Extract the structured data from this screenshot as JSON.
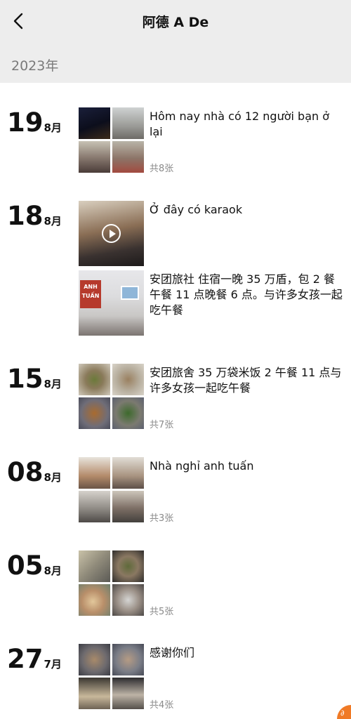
{
  "header": {
    "title": "阿德 A De"
  },
  "year": "2023年",
  "icons": {
    "back": "chevron-left-icon",
    "play": "play-icon",
    "corner": "share-badge-icon"
  },
  "entries": [
    {
      "day": "19",
      "month": "8月",
      "caption": "Hôm nay nhà có 12 người bạn ở lại",
      "count": "共8张"
    },
    {
      "day": "18",
      "month": "8月",
      "caption": "Ở đây có karaok",
      "count": ""
    },
    {
      "day": "",
      "month": "",
      "caption": "安团旅社 住宿一晚 35 万盾，包 2 餐 午餐 11 点晚餐 6 点。与许多女孩一起吃午餐",
      "count": ""
    },
    {
      "day": "15",
      "month": "8月",
      "caption": "安团旅舍 35 万袋米饭 2 午餐 11 点与许多女孩一起吃午餐",
      "count": "共7张"
    },
    {
      "day": "08",
      "month": "8月",
      "caption": "Nhà nghỉ anh tuấn",
      "count": "共3张"
    },
    {
      "day": "05",
      "month": "8月",
      "caption": "",
      "count": "共5张"
    },
    {
      "day": "27",
      "month": "7月",
      "caption": "感谢你们",
      "count": "共4张"
    }
  ],
  "sign_text": {
    "line1": "ANH",
    "line2": "TUẤN"
  }
}
